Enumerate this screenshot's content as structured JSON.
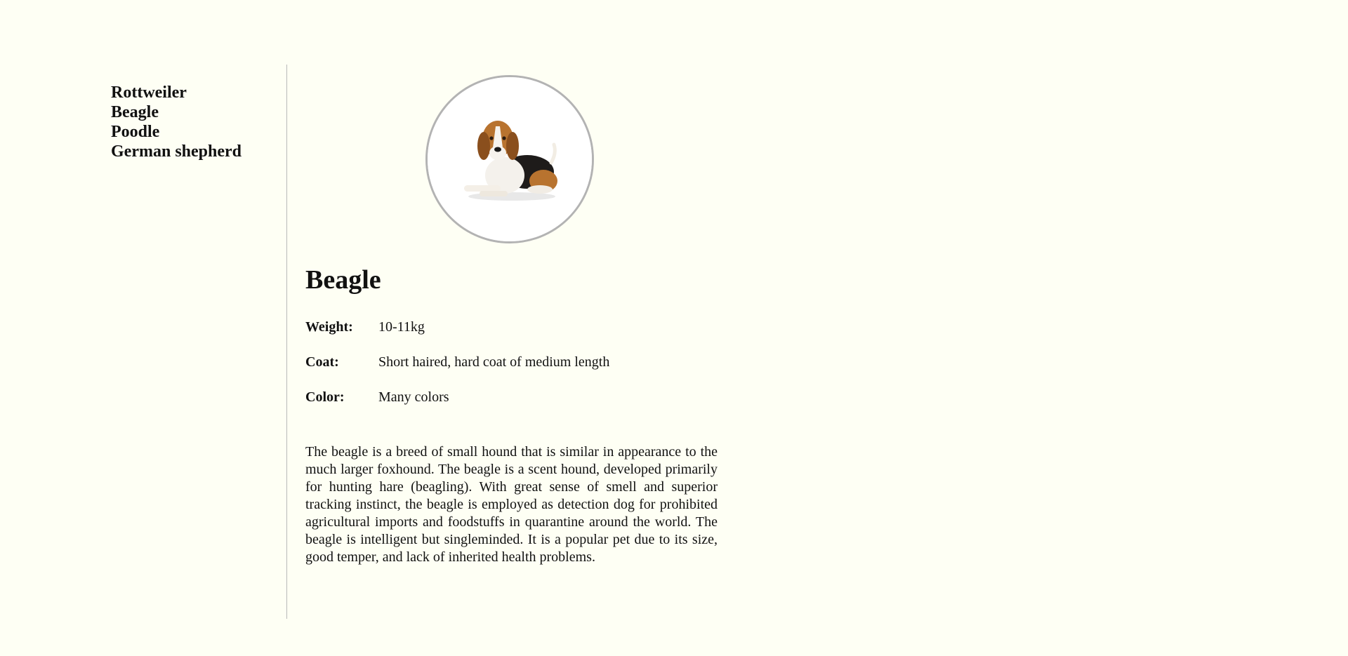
{
  "sidebar": {
    "items": [
      {
        "label": "Rottweiler"
      },
      {
        "label": "Beagle"
      },
      {
        "label": "Poodle"
      },
      {
        "label": "German shepherd"
      }
    ]
  },
  "breed": {
    "title": "Beagle",
    "specs": {
      "weight": {
        "label": "Weight:",
        "value": "10-11kg"
      },
      "coat": {
        "label": "Coat:",
        "value": "Short haired, hard coat of medium length"
      },
      "color": {
        "label": "Color:",
        "value": "Many colors"
      }
    },
    "description": "The beagle is a breed of small hound that is similar in appearance to the much larger foxhound. The beagle is a scent hound, developed primarily for hunting hare (beagling). With great sense of smell and superior tracking instinct, the beagle is employed as detection dog for prohibited agricultural imports and foodstuffs in quarantine around the world. The beagle is intelligent but singleminded. It is a popular pet due to its size, good temper, and lack of inherited health problems."
  },
  "colors": {
    "background": "#fefff4",
    "divider": "#b9b9b9",
    "photo_border": "#b3b3b3"
  }
}
